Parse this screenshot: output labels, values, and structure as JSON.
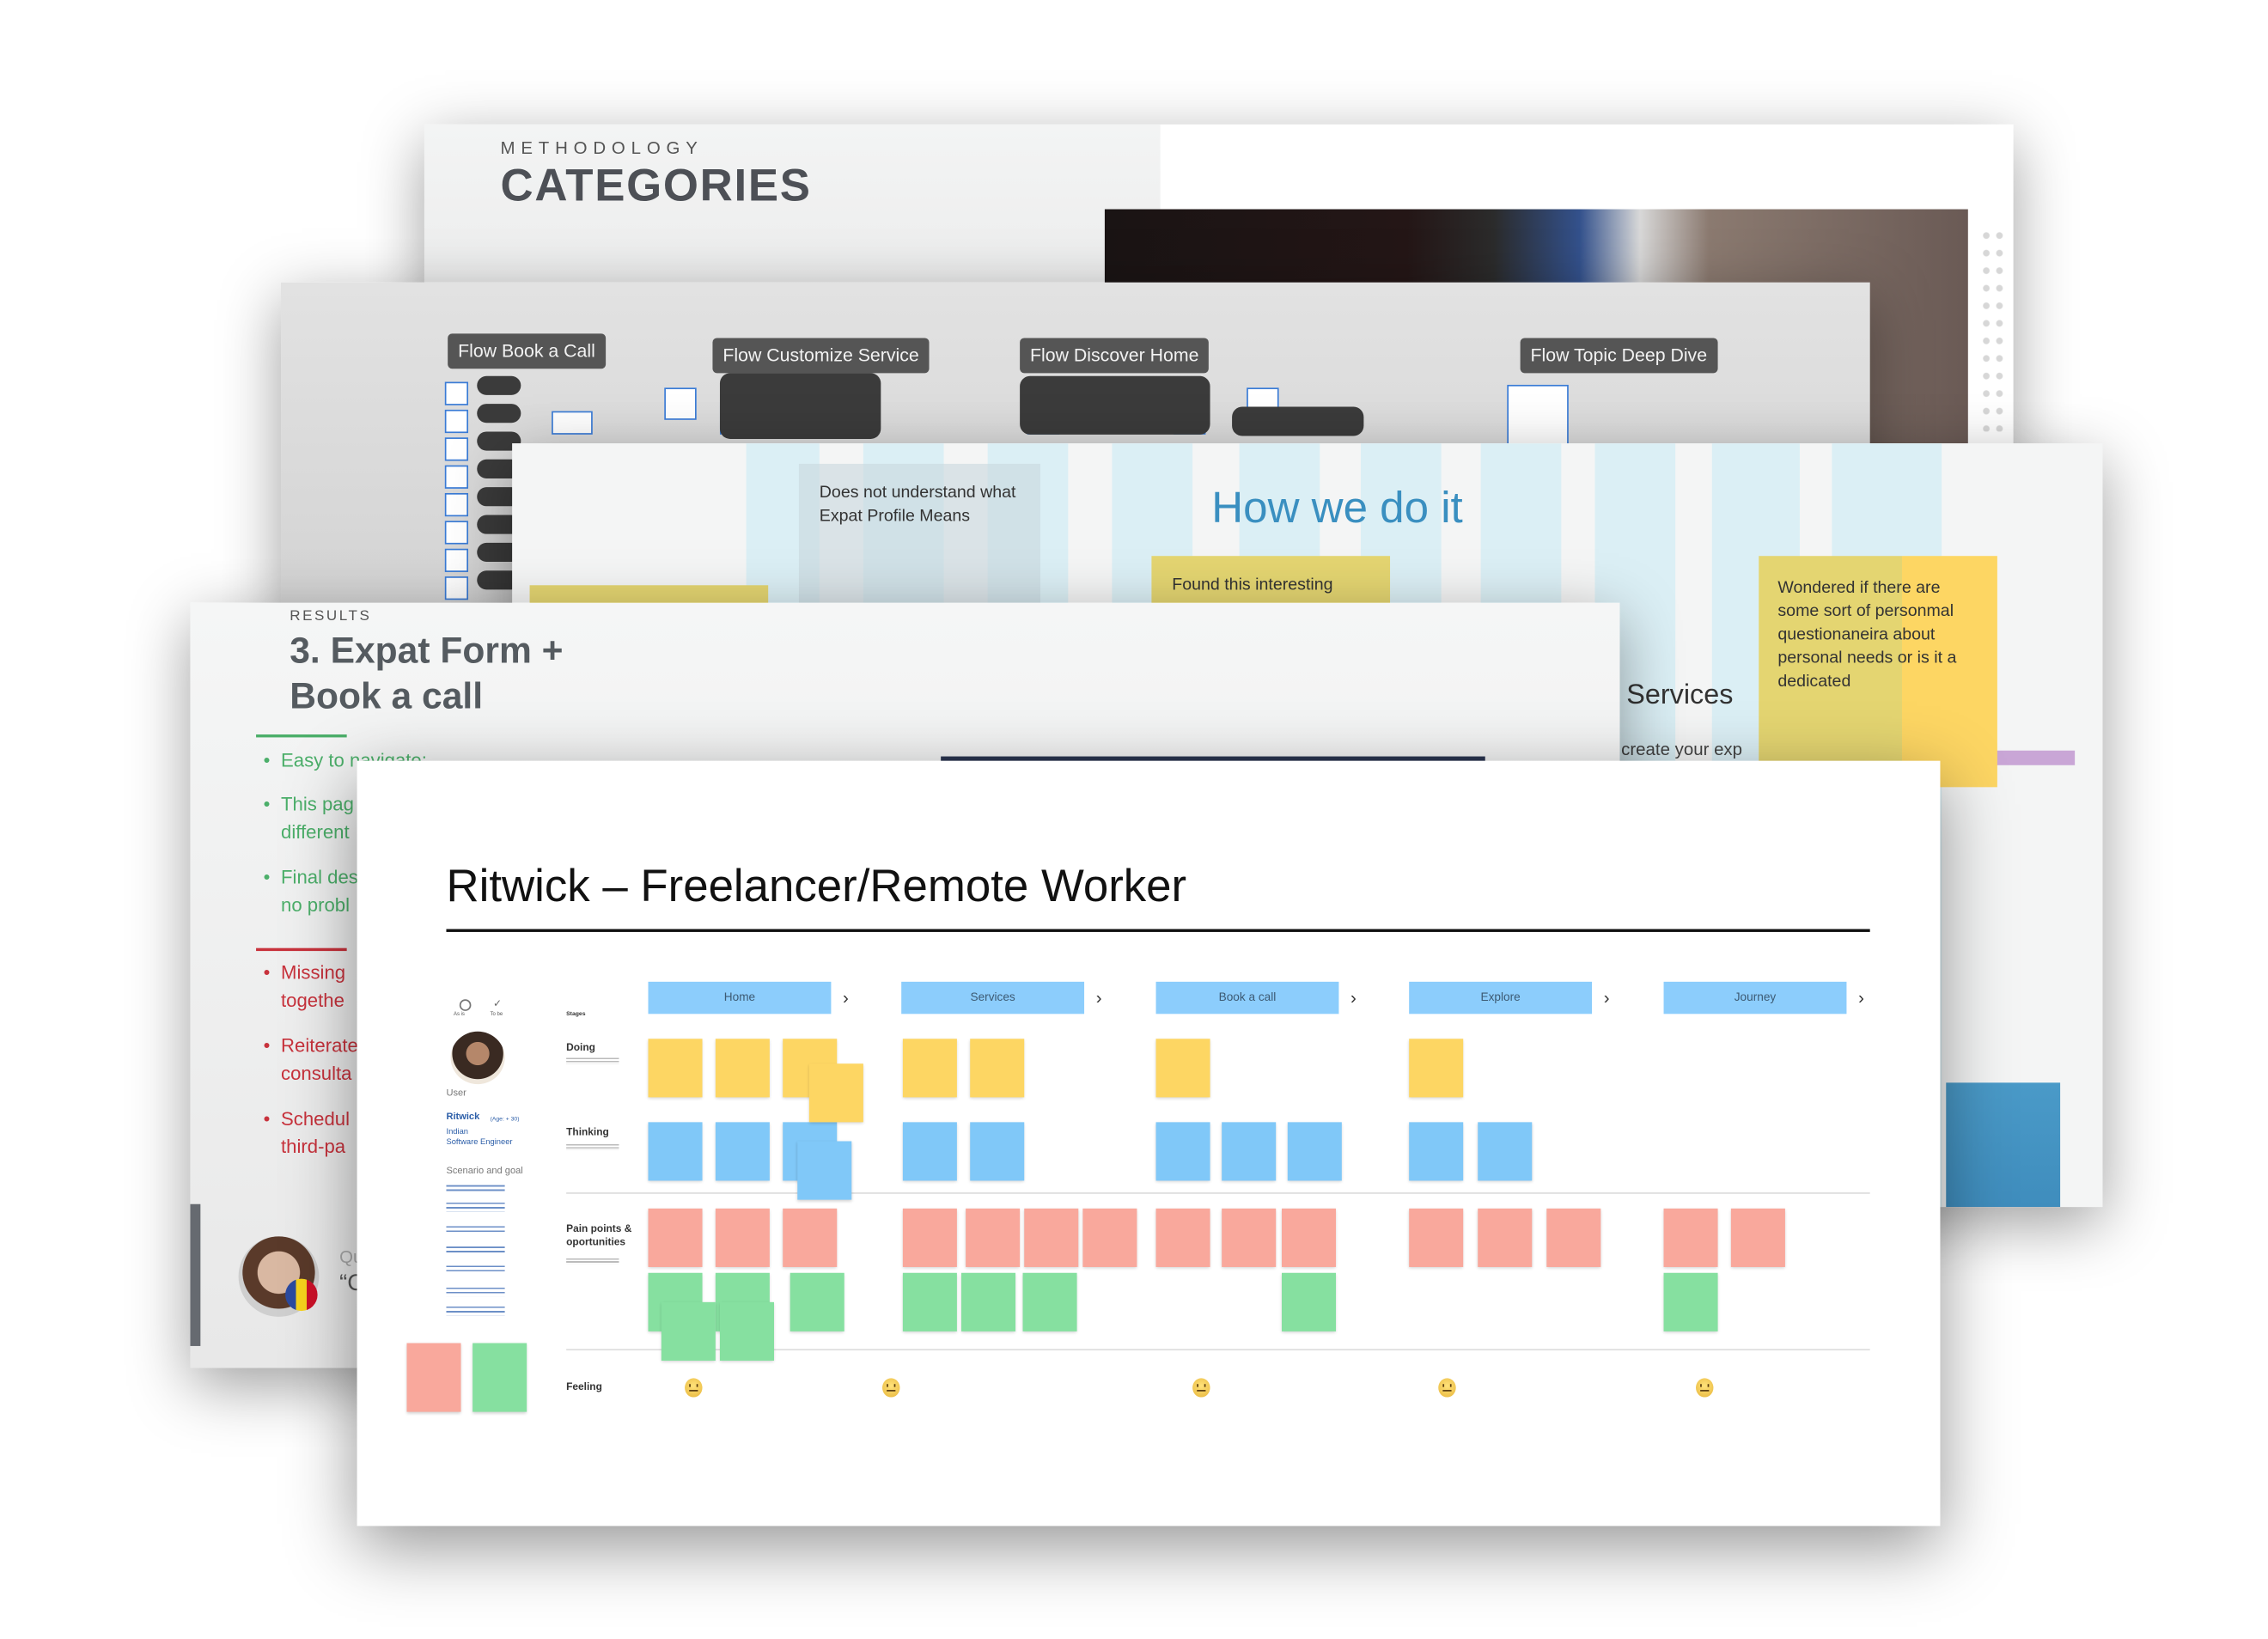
{
  "slides": {
    "methodology": {
      "eyebrow": "METHODOLOGY",
      "title": "CATEGORIES"
    },
    "flows": {
      "labels": [
        "Flow Book a Call",
        "Flow Customize Service",
        "Flow Discover Home",
        "Flow Topic Deep Dive"
      ]
    },
    "how_we_do_it": {
      "title": "How we do it",
      "note": "Does not understand what Expat Profile Means",
      "sticky_left": "Found this interesting",
      "sticky_right": "Wondered if there are some  sort of personmal questionaneira about personal needs or is it a dedicated",
      "partial_heading": "r Services",
      "partial_text": "create your exp"
    },
    "results": {
      "eyebrow": "RESULTS",
      "title_line1": "3. Expat Form +",
      "title_line2": "Book a call",
      "positives": [
        [
          "Easy to navigate:"
        ],
        [
          "This pag",
          "different"
        ],
        [
          "Final des",
          "no probl"
        ]
      ],
      "negatives": [
        [
          "Missing",
          "togethe"
        ],
        [
          "Reiterate",
          "consulta"
        ],
        [
          "Schedul",
          "third-pa"
        ]
      ],
      "quote_label": "Qu",
      "quote_start": "“C",
      "positive_color": "#4caf6a",
      "negative_color": "#c8323c"
    },
    "journey_map": {
      "title": "Ritwick – Freelancer/Remote Worker",
      "persona": {
        "as_is": "As is",
        "to_be": "To be",
        "section_user": "User",
        "name": "Ritwick",
        "age": "(Age: + 30)",
        "nationality": "Indian",
        "role": "Software Engineer",
        "section_scenario": "Scenario and goal"
      },
      "row_labels": {
        "stages": "Stages",
        "doing": "Doing",
        "thinking": "Thinking",
        "pain_line1": "Pain points &",
        "pain_line2": "oportunities",
        "feeling": "Feeling"
      },
      "stages": [
        {
          "label": "Home",
          "feeling": "neutral-face-icon"
        },
        {
          "label": "Services",
          "feeling": "grinning-face-icon"
        },
        {
          "label": "Book a call",
          "feeling": "neutral-face-icon"
        },
        {
          "label": "Explore",
          "feeling": "neutral-face-icon"
        },
        {
          "label": "Journey",
          "feeling": "thinking-face-icon"
        }
      ],
      "colors": {
        "stage_header": "#8ccdfc",
        "doing": "#fdd663",
        "thinking": "#80c8f8",
        "pain": "#f9a89c",
        "opportunity": "#86e0a0"
      }
    }
  }
}
